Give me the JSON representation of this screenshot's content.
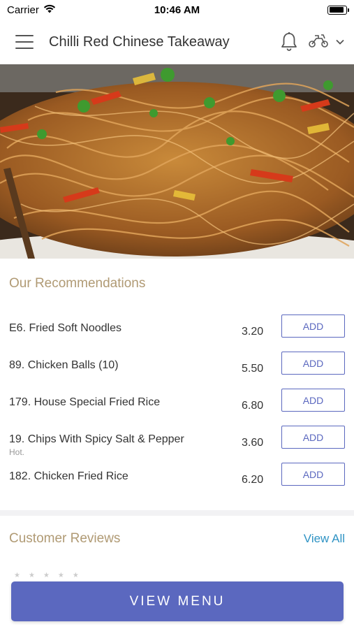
{
  "status_bar": {
    "carrier": "Carrier",
    "time": "10:46 AM",
    "battery_level": 0.9
  },
  "header": {
    "title": "Chilli Red Chinese Takeaway",
    "menu_icon": "hamburger-menu-icon",
    "notification_icon": "bell-icon",
    "delivery_icon": "scooter-icon",
    "dropdown_icon": "chevron-down-icon"
  },
  "hero": {
    "image": "noodles-photo"
  },
  "recommendations": {
    "title": "Our Recommendations",
    "items": [
      {
        "name": "E6. Fried Soft Noodles",
        "note": "",
        "price": "3.20",
        "button": "ADD"
      },
      {
        "name": "89. Chicken Balls (10)",
        "note": "",
        "price": "5.50",
        "button": "ADD"
      },
      {
        "name": "179. House Special Fried Rice",
        "note": "",
        "price": "6.80",
        "button": "ADD"
      },
      {
        "name": "19. Chips With Spicy Salt & Pepper",
        "note": "Hot.",
        "price": "3.60",
        "button": "ADD"
      },
      {
        "name": "182. Chicken Fried Rice",
        "note": "",
        "price": "6.20",
        "button": "ADD"
      }
    ]
  },
  "reviews": {
    "title": "Customer Reviews",
    "view_all": "View All"
  },
  "footer": {
    "view_menu": "VIEW MENU"
  },
  "colors": {
    "accent": "#5b68bf",
    "section_title": "#b09a74",
    "link": "#2f93c4"
  }
}
